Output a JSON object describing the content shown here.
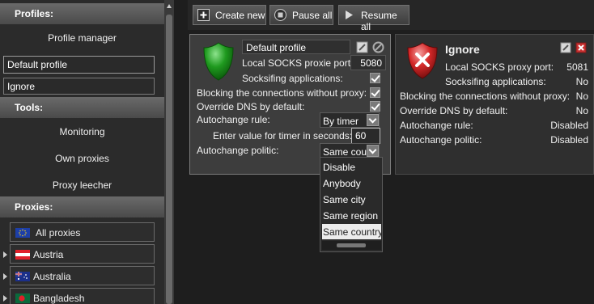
{
  "sidebar": {
    "profiles_header": "Profiles:",
    "profile_manager": "Profile manager",
    "profiles": [
      "Default profile",
      "Ignore"
    ],
    "tools_header": "Tools:",
    "tools": [
      "Monitoring",
      "Own proxies",
      "Proxy leecher"
    ],
    "proxies_header": "Proxies:",
    "proxies": [
      {
        "label": "All proxies",
        "icon": "eu-flag-icon"
      },
      {
        "label": "Austria",
        "icon": "austria-flag-icon"
      },
      {
        "label": "Australia",
        "icon": "australia-flag-icon"
      },
      {
        "label": "Bangladesh",
        "icon": "bangladesh-flag-icon"
      }
    ]
  },
  "toolbar": {
    "create_new": "Create new",
    "pause_all": "Pause all",
    "resume_all": "Resume all"
  },
  "default_profile": {
    "name": "Default profile",
    "socks_port_label": "Local SOCKS proxie port:",
    "socks_port": "5080",
    "socksifing_label": "Socksifing applications:",
    "blocking_label": "Blocking the connections without proxy:",
    "override_dns_label": "Override DNS by default:",
    "autochange_rule_label": "Autochange rule:",
    "autochange_rule_value": "By timer",
    "timer_label": "Enter value for timer in seconds:",
    "timer_value": "60",
    "autochange_politic_label": "Autochange politic:",
    "autochange_politic_value": "Same country",
    "socksifing_checked": true,
    "blocking_checked": true,
    "override_dns_checked": true
  },
  "politic_options": [
    "Disable",
    "Anybody",
    "Same city",
    "Same region",
    "Same country"
  ],
  "politic_selected_index": 4,
  "ignore_profile": {
    "name": "Ignore",
    "socks_port_label": "Local SOCKS proxy port:",
    "socks_port": "5081",
    "socksifing_label": "Socksifing applications:",
    "socksifing_value": "No",
    "blocking_label": "Blocking the connections without proxy:",
    "blocking_value": "No",
    "override_dns_label": "Override DNS by default:",
    "override_dns_value": "No",
    "autochange_rule_label": "Autochange rule:",
    "autochange_rule_value": "Disabled",
    "autochange_politic_label": "Autochange politic:",
    "autochange_politic_value": "Disabled"
  },
  "colors": {
    "shield_green": "#1f9a1f",
    "shield_red": "#d42828",
    "header_gray": "#5a5a5a",
    "background": "#1e1e1e"
  }
}
